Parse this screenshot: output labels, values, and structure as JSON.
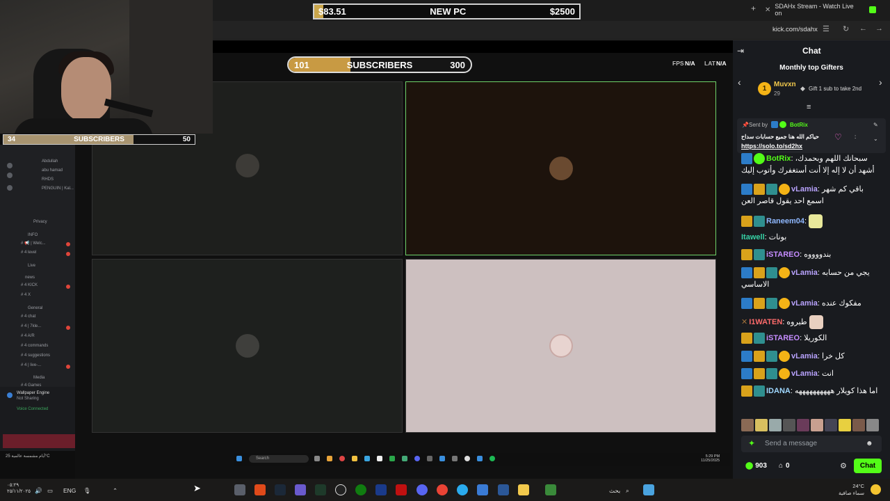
{
  "browser": {
    "tab_title": "SDAHx Stream - Watch Live on",
    "url": "kick.com/sdahx",
    "new_tab": "+",
    "tab_close": "✕"
  },
  "goal": {
    "left": "$83.51",
    "center": "NEW PC",
    "right": "$2500",
    "progress": 0.033
  },
  "webcam_subs": {
    "current": "34",
    "label": "SUBSCRIBERS",
    "goal": "50",
    "progress": 0.68
  },
  "stream_subs": {
    "current": "101",
    "label": "SUBSCRIBERS",
    "goal": "300",
    "progress": 0.34
  },
  "stream_stats": {
    "fps_label": "FPS",
    "fps_value": "N/A",
    "lat_label": "LAT",
    "lat_value": "N/A"
  },
  "discord": {
    "members": [
      "Abdullah",
      "abu hamad",
      "RHDS",
      "PENGUIN | Kal..."
    ],
    "privacy": "Privacy",
    "channels": [
      "# 📢 | Welc...",
      "# 4 level",
      "# 4 KICK",
      "# 4 X",
      "# 4 chat",
      "# 4 | 7kle...",
      "# 4 A/R",
      "# 4 commands",
      "# 4 suggestions",
      "# 4 | live-...",
      "# 4 Games"
    ],
    "categories": [
      "INFO",
      "Live",
      "news",
      "General",
      "Media"
    ],
    "wallpaper_engine": "Wallpaper Engine",
    "not_sharing": "Not Sharing",
    "voice_connected": "Voice Connected",
    "weather_mini": "أيام مشمسة عالمية 25°C"
  },
  "inner_taskbar": {
    "search": "Search",
    "time": "5:29 PM",
    "date": "11/25/2025"
  },
  "chat": {
    "title": "Chat",
    "gifters_title": "Monthly top Gifters",
    "top_gifter": {
      "rank": "1",
      "name": "Muvxn",
      "count": "29"
    },
    "gift_hint": "Gift 1 sub to take 2nd",
    "pinned": {
      "sent_by": "Sent by",
      "bot": "BotRix",
      "text": "حياكم الله هنا جميع حسابات سداح",
      "colon": ":",
      "link": "https://solo.to/sd2hx"
    },
    "messages": [
      {
        "name": "BotRix",
        "color": "#53fc18",
        "text": "سبحانك اللهم وبحمدك، أشهد أن لا إله إلا أنت أستغفرك وأتوب إليك"
      },
      {
        "name": "vLamia",
        "color": "#b9a3ff",
        "text": "باقي كم شهر اسمع احد يقول قاصر العن"
      },
      {
        "name": "Raneem04",
        "color": "#8fb8ff",
        "text": ""
      },
      {
        "name": "Itawell",
        "color": "#36d1a5",
        "text": "بونات"
      },
      {
        "name": "iSTAREO",
        "color": "#c58cff",
        "text": "بندووووه"
      },
      {
        "name": "vLamia",
        "color": "#b9a3ff",
        "text": "يجي من حسابه الاساسي"
      },
      {
        "name": "vLamia",
        "color": "#b9a3ff",
        "text": "مفكوك عنده"
      },
      {
        "name": "I1WATEN",
        "color": "#ff6b6b",
        "text": "طيروه"
      },
      {
        "name": "iSTAREO",
        "color": "#c58cff",
        "text": "الكوريلا"
      },
      {
        "name": "vLamia",
        "color": "#b9a3ff",
        "text": "كل خرا"
      },
      {
        "name": "vLamia",
        "color": "#b9a3ff",
        "text": "انت"
      },
      {
        "name": "IDANA",
        "color": "#9fd8ff",
        "text": "اما هذا كويلار ههههههههههه"
      }
    ],
    "input_placeholder": "Send a message",
    "kicks": "903",
    "gifts": "0",
    "chat_button": "Chat"
  },
  "taskbar": {
    "time": "٠٥:٢٩",
    "date": "٢٥/١١/٢٠٢٥",
    "lang": "ENG",
    "search": "بحث",
    "temp": "24°C",
    "weather": "سماء صافية"
  }
}
